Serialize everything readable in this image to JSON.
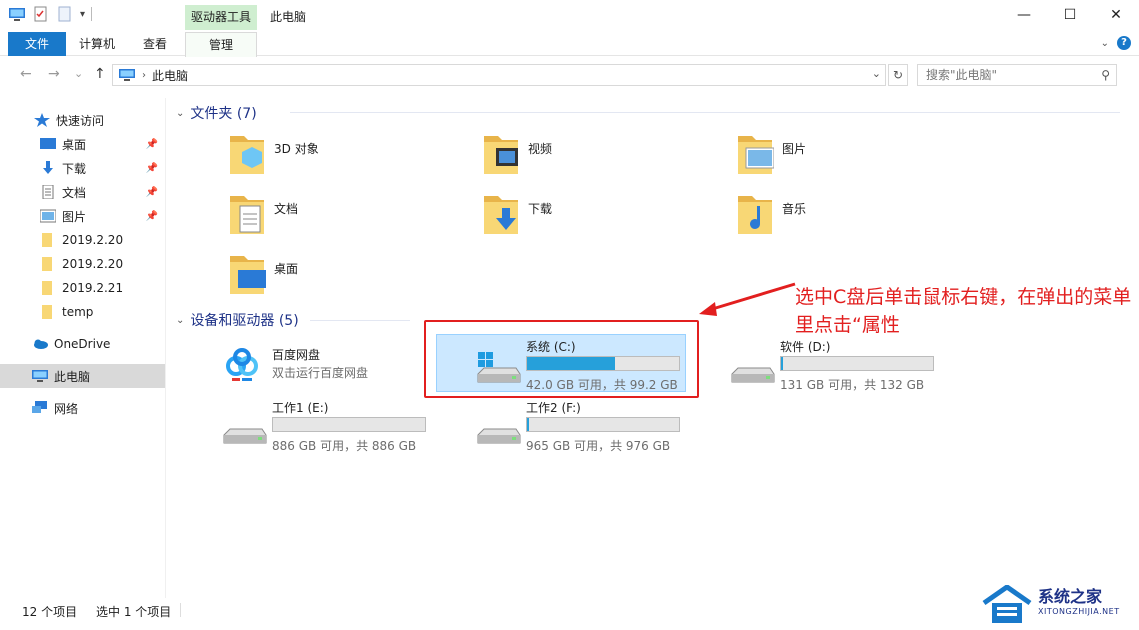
{
  "titlebar": {
    "context_tab": "驱动器工具",
    "title": "此电脑",
    "minimize": "—",
    "maximize": "☐",
    "close": "✕"
  },
  "ribbon": {
    "tabs": [
      "文件",
      "计算机",
      "查看",
      "管理"
    ]
  },
  "nav": {
    "back": "←",
    "forward": "→",
    "recent": "⌄",
    "up": "↑",
    "address": "此电脑",
    "search_placeholder": "搜索\"此电脑\""
  },
  "sidebar": {
    "items": [
      {
        "label": "快速访问",
        "icon": "star-icon"
      },
      {
        "label": "桌面",
        "icon": "desktop-icon",
        "pinned": true
      },
      {
        "label": "下载",
        "icon": "download-icon",
        "pinned": true
      },
      {
        "label": "文档",
        "icon": "document-icon",
        "pinned": true
      },
      {
        "label": "图片",
        "icon": "picture-icon",
        "pinned": true
      },
      {
        "label": "2019.2.20",
        "icon": "folder-icon"
      },
      {
        "label": "2019.2.20",
        "icon": "folder-icon"
      },
      {
        "label": "2019.2.21",
        "icon": "folder-icon"
      },
      {
        "label": "temp",
        "icon": "folder-icon"
      },
      {
        "label": "OneDrive",
        "icon": "cloud-icon"
      },
      {
        "label": "此电脑",
        "icon": "computer-icon",
        "selected": true
      },
      {
        "label": "网络",
        "icon": "network-icon"
      }
    ]
  },
  "folders_group": {
    "title": "文件夹 (7)",
    "items": [
      "3D 对象",
      "视频",
      "图片",
      "文档",
      "下载",
      "音乐",
      "桌面"
    ]
  },
  "devices_group": {
    "title": "设备和驱动器 (5)",
    "baidu": {
      "name": "百度网盘",
      "desc": "双击运行百度网盘"
    },
    "drives": [
      {
        "name": "系统 (C:)",
        "size": "42.0 GB 可用，共 99.2 GB",
        "used": 0.58
      },
      {
        "name": "软件 (D:)",
        "size": "131 GB 可用，共 132 GB",
        "used": 0.01
      },
      {
        "name": "工作1 (E:)",
        "size": "886 GB 可用，共 886 GB",
        "used": 0.0
      },
      {
        "name": "工作2 (F:)",
        "size": "965 GB 可用，共 976 GB",
        "used": 0.01
      }
    ]
  },
  "annotation": {
    "text": "选中C盘后单击鼠标右键，在弹出的菜单里点击“属性"
  },
  "status": {
    "count": "12 个项目",
    "selected": "选中 1 个项目"
  },
  "watermark": {
    "title": "系统之家",
    "sub": "XITONGZHIJIA.NET"
  },
  "colors": {
    "accent": "#1979ca",
    "selection": "#cce8ff",
    "bar_fill": "#26a0da",
    "annotation": "#e21f1f"
  }
}
